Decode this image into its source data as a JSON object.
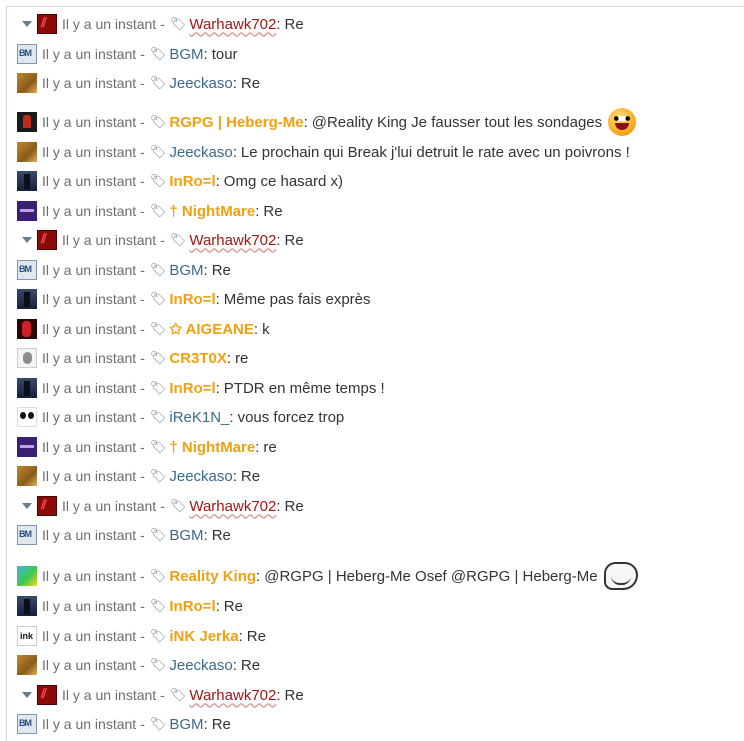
{
  "time_label": "Il y a un instant",
  "separator": "-",
  "colon": ":",
  "messages": [
    {
      "user": "Warhawk702",
      "text": "Re",
      "avatar": "warhawk-avatar",
      "style": "red",
      "collapsible": true
    },
    {
      "user": "BGM",
      "text": "tour",
      "avatar": "bgm-avatar",
      "style": "blue"
    },
    {
      "user": "Jeeckaso",
      "text": "Re",
      "avatar": "jeeckaso-avatar",
      "style": "blue"
    },
    {
      "user": "RGPG | Heberg-Me",
      "text": "@Reality King Je fausser tout les sondages",
      "avatar": "rgpg-avatar",
      "style": "gold",
      "emoji": "crazy-smiley-icon"
    },
    {
      "user": "Jeeckaso",
      "text": "Le prochain qui Break j'lui detruit le rate avec un poivrons !",
      "avatar": "jeeckaso-avatar",
      "style": "blue"
    },
    {
      "user": "InRo=l",
      "text": "Omg ce hasard x)",
      "avatar": "inro-avatar",
      "style": "gold"
    },
    {
      "user": "† NightMare",
      "text": "Re",
      "avatar": "nightmare-avatar",
      "style": "gold"
    },
    {
      "user": "Warhawk702",
      "text": "Re",
      "avatar": "warhawk-avatar",
      "style": "red",
      "collapsible": true
    },
    {
      "user": "BGM",
      "text": "Re",
      "avatar": "bgm-avatar",
      "style": "blue"
    },
    {
      "user": "InRo=l",
      "text": "Même pas fais exprès",
      "avatar": "inro-avatar",
      "style": "gold"
    },
    {
      "user": "✩ AIGEANE",
      "text": "k",
      "avatar": "aigeane-avatar",
      "style": "gold"
    },
    {
      "user": "CR3T0X",
      "text": "re",
      "avatar": "cr3t0x-avatar",
      "style": "gold"
    },
    {
      "user": "InRo=l",
      "text": "PTDR en même temps !",
      "avatar": "inro-avatar",
      "style": "gold"
    },
    {
      "user": "iReK1N_",
      "text": "vous forcez trop",
      "avatar": "irekin-avatar",
      "style": "blue"
    },
    {
      "user": "† NightMare",
      "text": "re",
      "avatar": "nightmare-avatar",
      "style": "gold"
    },
    {
      "user": "Jeeckaso",
      "text": "Re",
      "avatar": "jeeckaso-avatar",
      "style": "blue"
    },
    {
      "user": "Warhawk702",
      "text": "Re",
      "avatar": "warhawk-avatar",
      "style": "red",
      "collapsible": true
    },
    {
      "user": "BGM",
      "text": "Re",
      "avatar": "bgm-avatar",
      "style": "blue"
    },
    {
      "user": "Reality King",
      "text": "@RGPG | Heberg-Me Osef @RGPG | Heberg-Me",
      "avatar": "reality-king-avatar",
      "style": "gold",
      "emoji": "troll-face-icon"
    },
    {
      "user": "InRo=l",
      "text": "Re",
      "avatar": "inro-avatar",
      "style": "gold"
    },
    {
      "user": "iNK Jerka",
      "text": "Re",
      "avatar": "ink-jerka-avatar",
      "style": "gold"
    },
    {
      "user": "Jeeckaso",
      "text": "Re",
      "avatar": "jeeckaso-avatar",
      "style": "blue"
    },
    {
      "user": "Warhawk702",
      "text": "Re",
      "avatar": "warhawk-avatar",
      "style": "red",
      "collapsible": true
    },
    {
      "user": "BGM",
      "text": "Re",
      "avatar": "bgm-avatar",
      "style": "blue"
    }
  ]
}
